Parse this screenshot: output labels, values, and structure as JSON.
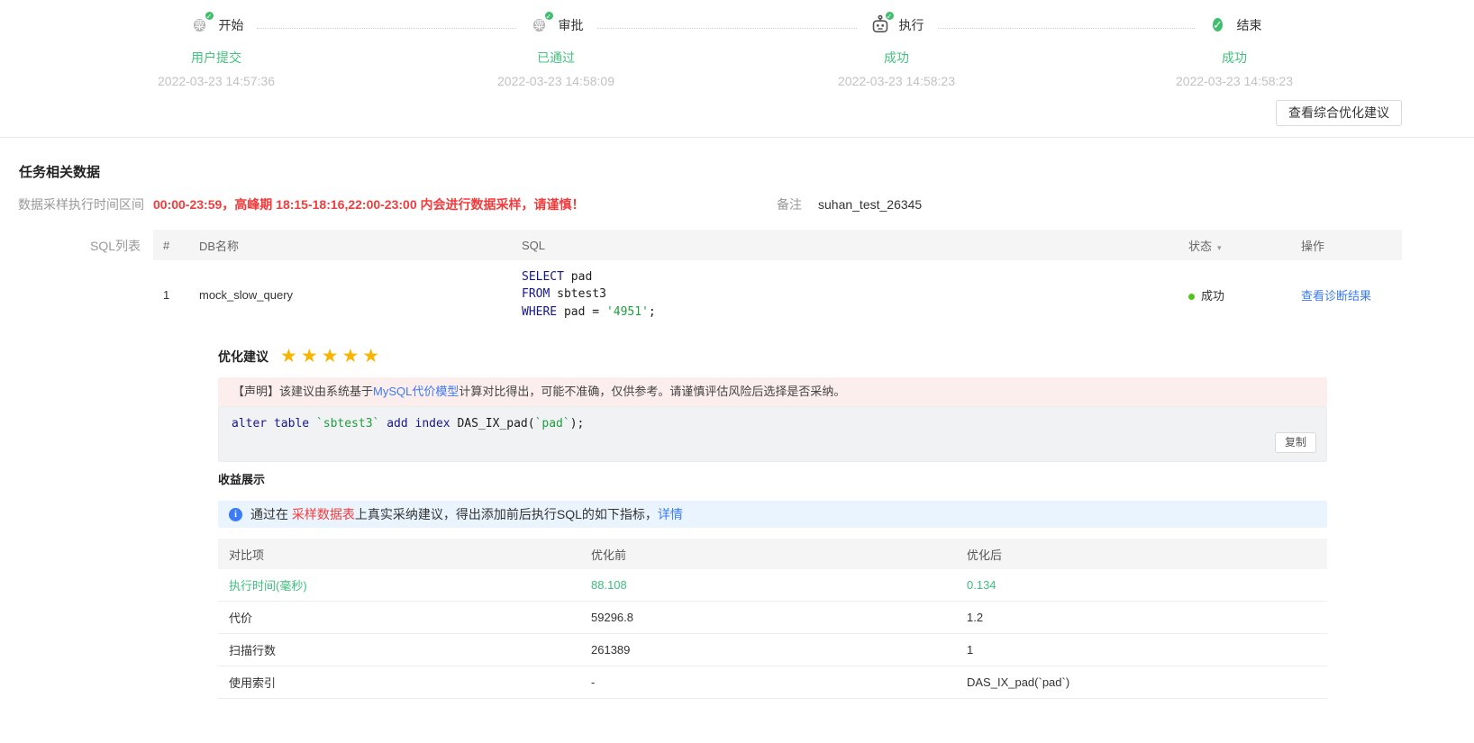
{
  "colors": {
    "green_step": "#3fbf6e",
    "green_dot": "#52c41a",
    "green_value": "#3dbd7d",
    "red_warning": "#f43b3b",
    "blue_link": "#3c7bf6",
    "star_gold": "#f7b500",
    "pink_banner_bg": "#fdeeee",
    "blue_banner_bg": "#e9f4fe"
  },
  "icons": {
    "check": "✓",
    "caret_down": "▾",
    "info": "i",
    "stars": "★★★★★"
  },
  "stepper": {
    "avatar_char": "粟",
    "steps": [
      {
        "label": "开始",
        "status": "用户提交",
        "time": "2022-03-23 14:57:36"
      },
      {
        "label": "审批",
        "status": "已通过",
        "time": "2022-03-23 14:58:09"
      },
      {
        "label": "执行",
        "status": "成功",
        "time": "2022-03-23 14:58:23"
      },
      {
        "label": "结束",
        "status": "成功",
        "time": "2022-03-23 14:58:23"
      }
    ]
  },
  "toolbar": {
    "view_suggestion_button": "查看综合优化建议"
  },
  "task_section": {
    "title": "任务相关数据",
    "sampling_label": "数据采样执行时间区间",
    "sampling_warning": "00:00-23:59，高峰期 18:15-18:16,22:00-23:00 内会进行数据采样，请谨慎！",
    "remark_label": "备注",
    "remark_value": "suhan_test_26345"
  },
  "sql_list": {
    "label": "SQL列表",
    "columns": [
      "#",
      "DB名称",
      "SQL",
      "状态",
      "操作"
    ],
    "row": {
      "index": "1",
      "db": "mock_slow_query",
      "status": "成功",
      "action": "查看诊断结果"
    },
    "row_sql": {
      "l1_kw": "SELECT",
      "l1_rest": " pad",
      "l2_kw": "FROM",
      "l2_rest": " sbtest3",
      "l3_kw": "WHERE",
      "l3_mid": " pad = ",
      "l3_str": "'4951'",
      "l3_end": ";"
    }
  },
  "suggestion": {
    "title": "优化建议",
    "rating": 5,
    "disclaimer_prefix": "【声明】该建议由系统基于",
    "disclaimer_link": "MySQL代价模型",
    "disclaimer_suffix": "计算对比得出，可能不准确，仅供参考。请谨慎评估风险后选择是否采纳。",
    "sql_full": "alter table `sbtest3` add index DAS_IX_pad(`pad`);",
    "sql_tokens": {
      "kw1": "alter table",
      "tick1": " `sbtest3` ",
      "kw2": "add index",
      "mid": " DAS_IX_pad(",
      "tick2": "`pad`",
      "end": ");"
    },
    "copy_button": "复制"
  },
  "benefit": {
    "title": "收益展示",
    "info_prefix": "通过在 ",
    "info_highlight": "采样数据表",
    "info_middle": "上真实采纳建议，得出添加前后执行SQL的如下指标，",
    "info_link": "详情",
    "table": {
      "columns": [
        "对比项",
        "优化前",
        "优化后"
      ],
      "rows": [
        {
          "item": "执行时间(毫秒)",
          "before": "88.108",
          "after": "0.134"
        },
        {
          "item": "代价",
          "before": "59296.8",
          "after": "1.2"
        },
        {
          "item": "扫描行数",
          "before": "261389",
          "after": "1"
        },
        {
          "item": "使用索引",
          "before": "-",
          "after": "DAS_IX_pad(`pad`)"
        }
      ]
    }
  }
}
